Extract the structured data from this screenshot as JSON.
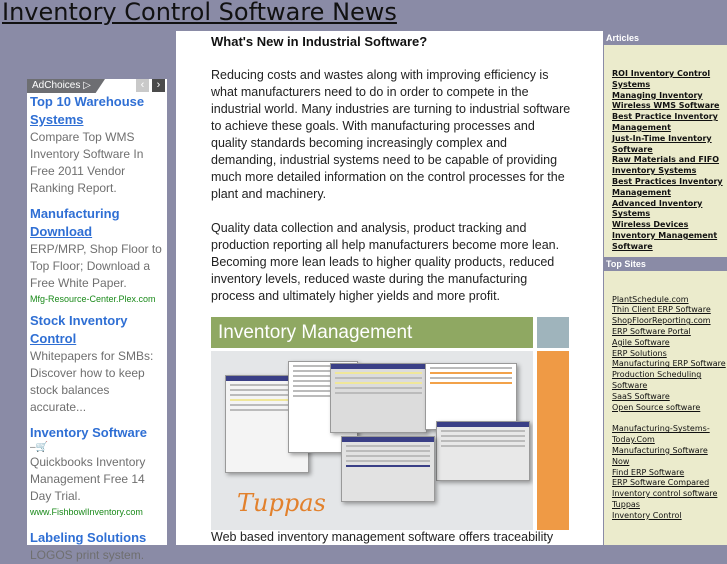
{
  "site": {
    "title": "Inventory Control Software News"
  },
  "ads": {
    "adchoices_label": "AdChoices ▷",
    "prev_icon": "‹",
    "next_icon": "›",
    "items": [
      {
        "title_line1": "Top 10 Warehouse",
        "title_line2": "Systems",
        "description": "Compare Top WMS Inventory Software In Free 2011 Vendor Ranking Report.",
        "url": ""
      },
      {
        "title_line1": "Manufacturing",
        "title_line2": "Download",
        "description": "ERP/MRP, Shop Floor to Top Floor; Download a Free White Paper.",
        "url": "Mfg-Resource-Center.Plex.com"
      },
      {
        "title_line1": "Stock Inventory",
        "title_line2": "Control",
        "description": "Whitepapers for SMBs: Discover how to keep stock balances accurate...",
        "url": ""
      },
      {
        "title_line1": "Inventory Software",
        "title_line2": "",
        "icon": "cart-icon",
        "description": "Quickbooks Inventory Management Free 14 Day Trial.",
        "url": "www.FishbowlInventory.com"
      },
      {
        "title_line1": "Labeling Solutions",
        "title_line2": "",
        "description": "LOGOS print system.",
        "url": ""
      }
    ]
  },
  "main": {
    "heading": "What's New in Industrial Software?",
    "paragraphs": [
      "Reducing costs and wastes along with improving efficiency is what manufacturers need to do in order to compete in the industrial world. Many industries are turning to industrial software to achieve these goals. With manufacturing processes and quality standards becoming increasingly complex and demanding, industrial systems need to be capable of providing much more detailed information on the control processes for the plant and machinery.",
      "Quality data collection and analysis, product tracking and production reporting all help manufacturers become more lean. Becoming more lean leads to higher quality products, reduced inventory levels, reduced waste during the manufacturing process and ultimately higher yields and more profit.",
      "Web based inventory management software offers traceability"
    ],
    "banner": {
      "title": "Inventory Management",
      "logo_text": "Tuppas"
    }
  },
  "sidebar": {
    "articles": {
      "heading": "Articles",
      "links": [
        "ROI Inventory Control Systems",
        "Managing Inventory",
        "Wireless WMS Software",
        "Best Practice Inventory Management",
        "Just-In-Time Inventory Software",
        "Raw Materials and FIFO Inventory Systems",
        "Best Practices Inventory Management",
        "Advanced Inventory Systems",
        "Wireless Devices",
        "Inventory Management Software"
      ]
    },
    "top_sites": {
      "heading": "Top Sites",
      "group1": [
        "PlantSchedule.com",
        "Thin Client ERP Software",
        "ShopFloorReporting.com",
        "ERP Software Portal",
        "Agile Software",
        "ERP Solutions",
        "Manufacturing ERP Software",
        "Production Scheduling Software",
        "SaaS Software",
        "Open Source software"
      ],
      "group2": [
        "Manufacturing-Systems-Today.Com",
        "Manufacturing Software Now",
        "Find ERP Software",
        "ERP Software Compared",
        "Inventory control software Tuppas",
        "Inventory Control"
      ]
    }
  }
}
